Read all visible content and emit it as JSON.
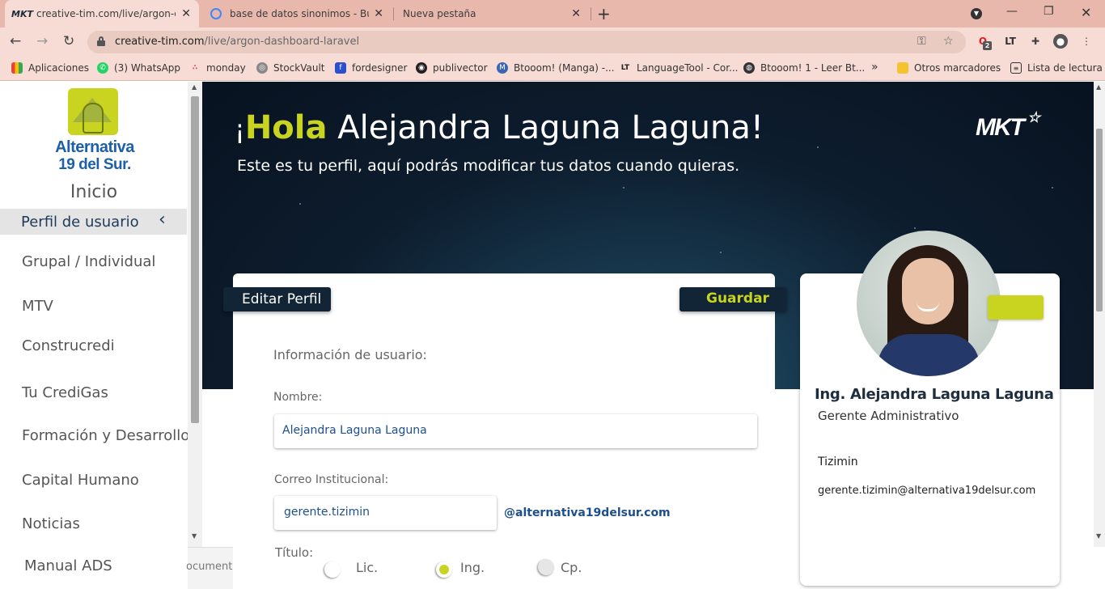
{
  "browser": {
    "tabs": [
      {
        "title": "creative-tim.com/live/argon-dashboard-laravel",
        "active": true
      },
      {
        "title": "base de datos sinonimos - Buscar",
        "active": false
      },
      {
        "title": "Nueva pestaña",
        "active": false
      }
    ],
    "tab_favicon_text": "MKT",
    "close_glyph": "✕",
    "new_tab_glyph": "+",
    "url_host": "creative-tim.com",
    "url_path": "/live/argon-dashboard-laravel",
    "extension_badge": "2",
    "bookmarks": [
      "Aplicaciones",
      "(3) WhatsApp",
      "monday",
      "StockVault",
      "fordesigner",
      "publivector",
      "Btooom! (Manga) -...",
      "LanguageTool - Cor...",
      "Btooom! 1 - Leer Bt...",
      "»",
      "Otros marcadores",
      "Lista de lectura"
    ]
  },
  "sidebar": {
    "logo_line1": "Alternativa",
    "logo_line2": "19 del Sur.",
    "home": "Inicio",
    "active_item": "Perfil de usuario",
    "chevron": "‹",
    "items": [
      "Grupal / Individual",
      "MTV",
      "Construcredi",
      "Tu CrediGas",
      "Formación y Desarrollo",
      "Capital Humano",
      "Noticias",
      "Manual ADS"
    ],
    "ghost_text": "ocumenta"
  },
  "hero": {
    "greeting_open": "¡",
    "greeting_highlight": "Hola",
    "greeting_name": " Alejandra Laguna Laguna!",
    "subtitle": "Este es tu perfil, aquí podrás modificar tus datos cuando quieras.",
    "brand_logo": "MKT"
  },
  "form": {
    "edit_badge": "Editar Perfil",
    "save_button": "Guardar",
    "section_title": "Información de usuario:",
    "name_label": "Nombre:",
    "name_value": "Alejandra Laguna Laguna",
    "email_label": "Correo Institucional:",
    "email_value": "gerente.tizimin",
    "email_domain": "@alternativa19delsur.com",
    "title_label": "Título:",
    "title_options": [
      "Lic.",
      "Ing.",
      "Cp."
    ],
    "title_selected": "Ing."
  },
  "profile": {
    "name": "Ing. Alejandra Laguna Laguna",
    "role": "Gerente Administrativo",
    "city": "Tizimin",
    "email": "gerente.tizimin@alternativa19delsur.com"
  },
  "colors": {
    "accent_green": "#c8d41f",
    "navy": "#122536",
    "link_blue": "#1d4f8c",
    "logo_blue": "#1d5fa8",
    "tab_bar": "#e8b8ad"
  }
}
